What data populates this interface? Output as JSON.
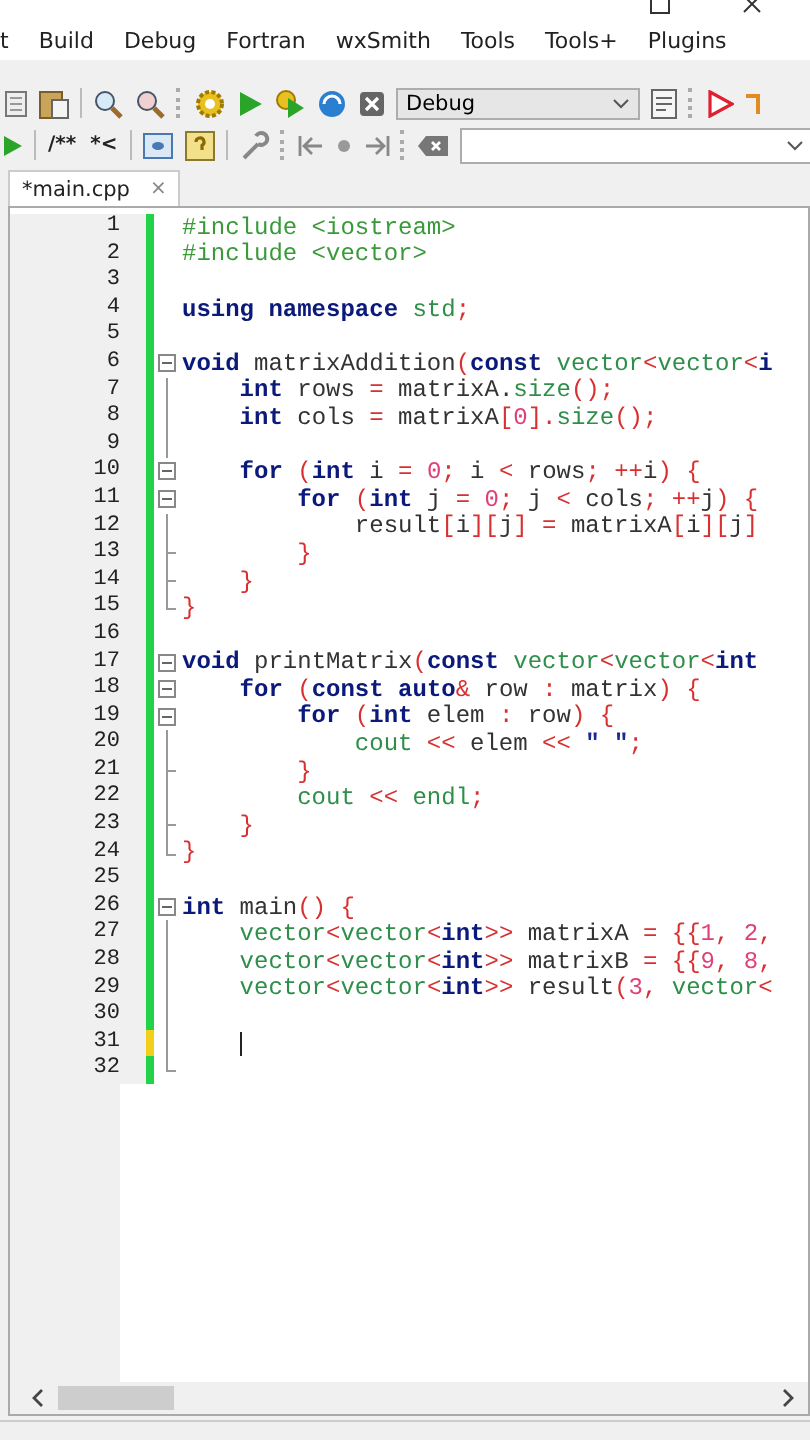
{
  "menu": [
    "t",
    "Build",
    "Debug",
    "Fortran",
    "wxSmith",
    "Tools",
    "Tools+",
    "Plugins"
  ],
  "toolbar": {
    "target": "Debug",
    "doc_buttons": [
      "/**",
      "*<"
    ]
  },
  "tabs": [
    {
      "label": "*main.cpp",
      "close": "×",
      "selected": true
    }
  ],
  "lines": [
    {
      "number": "1",
      "color": "#22d34a",
      "kind": "plain",
      "caret": false,
      "tokens": [
        {
          "t": "#include <iostream>",
          "kind": "pre"
        }
      ]
    },
    {
      "number": "2",
      "color": "#22d34a",
      "kind": "plain",
      "caret": false,
      "tokens": [
        {
          "t": "#include <vector>",
          "kind": "pre"
        }
      ]
    },
    {
      "number": "3",
      "color": "#22d34a",
      "kind": "plain",
      "caret": false
    },
    {
      "number": "4",
      "color": "#22d34a",
      "kind": "plain",
      "caret": false,
      "tokens": [
        {
          "t": "using namespace",
          "kind": "kw"
        },
        {
          "t": " std",
          "kind": "lib"
        },
        {
          "t": ";",
          "kind": "p"
        }
      ]
    },
    {
      "number": "5",
      "color": "#22d34a",
      "kind": "plain",
      "caret": false
    },
    {
      "number": "6",
      "color": "#22d34a",
      "kind": "start",
      "caret": false,
      "tokens": [
        {
          "t": "void",
          "kind": "kw"
        },
        {
          "t": " matrixAddition",
          "kind": "id"
        },
        {
          "t": "(",
          "kind": "p"
        },
        {
          "t": "const",
          "kind": "kw"
        },
        {
          "t": " vector",
          "kind": "lib"
        },
        {
          "t": "<",
          "kind": "p"
        },
        {
          "t": "vector",
          "kind": "lib"
        },
        {
          "t": "<",
          "kind": "p"
        },
        {
          "t": "i",
          "kind": "kw"
        }
      ]
    },
    {
      "number": "7",
      "color": "#22d34a",
      "kind": "inside",
      "caret": false,
      "tokens": [
        {
          "t": "    int",
          "kind": "kw"
        },
        {
          "t": " rows ",
          "kind": "id"
        },
        {
          "t": "=",
          "kind": "p"
        },
        {
          "t": " matrixA.",
          "kind": "id"
        },
        {
          "t": "size",
          "kind": "lib"
        },
        {
          "t": "();",
          "kind": "p"
        }
      ]
    },
    {
      "number": "8",
      "color": "#22d34a",
      "kind": "inside",
      "caret": false,
      "tokens": [
        {
          "t": "    int",
          "kind": "kw"
        },
        {
          "t": " cols ",
          "kind": "id"
        },
        {
          "t": "=",
          "kind": "p"
        },
        {
          "t": " matrixA",
          "kind": "id"
        },
        {
          "t": "[",
          "kind": "p"
        },
        {
          "t": "0",
          "kind": "num"
        },
        {
          "t": "].",
          "kind": "p"
        },
        {
          "t": "size",
          "kind": "lib"
        },
        {
          "t": "();",
          "kind": "p"
        }
      ]
    },
    {
      "number": "9",
      "color": "#22d34a",
      "kind": "inside",
      "caret": false
    },
    {
      "number": "10",
      "color": "#22d34a",
      "kind": "start",
      "caret": false,
      "tokens": [
        {
          "t": "    for",
          "kind": "kw"
        },
        {
          "t": " (",
          "kind": "p"
        },
        {
          "t": "int",
          "kind": "kw"
        },
        {
          "t": " i ",
          "kind": "id"
        },
        {
          "t": "=",
          "kind": "p"
        },
        {
          "t": " 0",
          "kind": "num"
        },
        {
          "t": ";",
          "kind": "p"
        },
        {
          "t": " i ",
          "kind": "id"
        },
        {
          "t": "<",
          "kind": "p"
        },
        {
          "t": " rows",
          "kind": "id"
        },
        {
          "t": ";",
          "kind": "p"
        },
        {
          "t": " ++",
          "kind": "p"
        },
        {
          "t": "i",
          "kind": "id"
        },
        {
          "t": ")",
          "kind": "p"
        },
        {
          "t": " {",
          "kind": "p"
        }
      ]
    },
    {
      "number": "11",
      "color": "#22d34a",
      "kind": "start",
      "caret": false,
      "tokens": [
        {
          "t": "        for",
          "kind": "kw"
        },
        {
          "t": " (",
          "kind": "p"
        },
        {
          "t": "int",
          "kind": "kw"
        },
        {
          "t": " j ",
          "kind": "id"
        },
        {
          "t": "=",
          "kind": "p"
        },
        {
          "t": " 0",
          "kind": "num"
        },
        {
          "t": ";",
          "kind": "p"
        },
        {
          "t": " j ",
          "kind": "id"
        },
        {
          "t": "<",
          "kind": "p"
        },
        {
          "t": " cols",
          "kind": "id"
        },
        {
          "t": ";",
          "kind": "p"
        },
        {
          "t": " ++",
          "kind": "p"
        },
        {
          "t": "j",
          "kind": "id"
        },
        {
          "t": ")",
          "kind": "p"
        },
        {
          "t": " {",
          "kind": "p"
        }
      ]
    },
    {
      "number": "12",
      "color": "#22d34a",
      "kind": "inside",
      "caret": false,
      "tokens": [
        {
          "t": "            result",
          "kind": "id"
        },
        {
          "t": "[",
          "kind": "p"
        },
        {
          "t": "i",
          "kind": "id"
        },
        {
          "t": "][",
          "kind": "p"
        },
        {
          "t": "j",
          "kind": "id"
        },
        {
          "t": "]",
          "kind": "p"
        },
        {
          "t": " =",
          "kind": "p"
        },
        {
          "t": " matrixA",
          "kind": "id"
        },
        {
          "t": "[",
          "kind": "p"
        },
        {
          "t": "i",
          "kind": "id"
        },
        {
          "t": "][",
          "kind": "p"
        },
        {
          "t": "j",
          "kind": "id"
        },
        {
          "t": "]",
          "kind": "p"
        }
      ]
    },
    {
      "number": "13",
      "color": "#22d34a",
      "kind": "branch",
      "caret": false,
      "tokens": [
        {
          "t": "        }",
          "kind": "p"
        }
      ]
    },
    {
      "number": "14",
      "color": "#22d34a",
      "kind": "branch",
      "caret": false,
      "tokens": [
        {
          "t": "    }",
          "kind": "p"
        }
      ]
    },
    {
      "number": "15",
      "color": "#22d34a",
      "kind": "end",
      "caret": false,
      "tokens": [
        {
          "t": "}",
          "kind": "p"
        }
      ]
    },
    {
      "number": "16",
      "color": "#22d34a",
      "kind": "plain",
      "caret": false
    },
    {
      "number": "17",
      "color": "#22d34a",
      "kind": "start",
      "caret": false,
      "tokens": [
        {
          "t": "void",
          "kind": "kw"
        },
        {
          "t": " printMatrix",
          "kind": "id"
        },
        {
          "t": "(",
          "kind": "p"
        },
        {
          "t": "const",
          "kind": "kw"
        },
        {
          "t": " vector",
          "kind": "lib"
        },
        {
          "t": "<",
          "kind": "p"
        },
        {
          "t": "vector",
          "kind": "lib"
        },
        {
          "t": "<",
          "kind": "p"
        },
        {
          "t": "int",
          "kind": "kw"
        }
      ]
    },
    {
      "number": "18",
      "color": "#22d34a",
      "kind": "start",
      "caret": false,
      "tokens": [
        {
          "t": "    for",
          "kind": "kw"
        },
        {
          "t": " (",
          "kind": "p"
        },
        {
          "t": "const auto",
          "kind": "kw"
        },
        {
          "t": "&",
          "kind": "p"
        },
        {
          "t": " row ",
          "kind": "id"
        },
        {
          "t": ":",
          "kind": "p"
        },
        {
          "t": " matrix",
          "kind": "id"
        },
        {
          "t": ")",
          "kind": "p"
        },
        {
          "t": " {",
          "kind": "p"
        }
      ]
    },
    {
      "number": "19",
      "color": "#22d34a",
      "kind": "start",
      "caret": false,
      "tokens": [
        {
          "t": "        for",
          "kind": "kw"
        },
        {
          "t": " (",
          "kind": "p"
        },
        {
          "t": "int",
          "kind": "kw"
        },
        {
          "t": " elem ",
          "kind": "id"
        },
        {
          "t": ":",
          "kind": "p"
        },
        {
          "t": " row",
          "kind": "id"
        },
        {
          "t": ")",
          "kind": "p"
        },
        {
          "t": " {",
          "kind": "p"
        }
      ]
    },
    {
      "number": "20",
      "color": "#22d34a",
      "kind": "inside",
      "caret": false,
      "tokens": [
        {
          "t": "            cout",
          "kind": "lib"
        },
        {
          "t": " <<",
          "kind": "p"
        },
        {
          "t": " elem ",
          "kind": "id"
        },
        {
          "t": "<<",
          "kind": "p"
        },
        {
          "t": " \" \"",
          "kind": "str"
        },
        {
          "t": ";",
          "kind": "p"
        }
      ]
    },
    {
      "number": "21",
      "color": "#22d34a",
      "kind": "branch",
      "caret": false,
      "tokens": [
        {
          "t": "        }",
          "kind": "p"
        }
      ]
    },
    {
      "number": "22",
      "color": "#22d34a",
      "kind": "inside",
      "caret": false,
      "tokens": [
        {
          "t": "        cout",
          "kind": "lib"
        },
        {
          "t": " <<",
          "kind": "p"
        },
        {
          "t": " endl",
          "kind": "lib"
        },
        {
          "t": ";",
          "kind": "p"
        }
      ]
    },
    {
      "number": "23",
      "color": "#22d34a",
      "kind": "branch",
      "caret": false,
      "tokens": [
        {
          "t": "    }",
          "kind": "p"
        }
      ]
    },
    {
      "number": "24",
      "color": "#22d34a",
      "kind": "end",
      "caret": false,
      "tokens": [
        {
          "t": "}",
          "kind": "p"
        }
      ]
    },
    {
      "number": "25",
      "color": "#22d34a",
      "kind": "plain",
      "caret": false
    },
    {
      "number": "26",
      "color": "#22d34a",
      "kind": "start",
      "caret": false,
      "tokens": [
        {
          "t": "int",
          "kind": "kw"
        },
        {
          "t": " main",
          "kind": "id"
        },
        {
          "t": "()",
          "kind": "p"
        },
        {
          "t": " {",
          "kind": "p"
        }
      ]
    },
    {
      "number": "27",
      "color": "#22d34a",
      "kind": "inside",
      "caret": false,
      "tokens": [
        {
          "t": "    vector",
          "kind": "lib"
        },
        {
          "t": "<",
          "kind": "p"
        },
        {
          "t": "vector",
          "kind": "lib"
        },
        {
          "t": "<",
          "kind": "p"
        },
        {
          "t": "int",
          "kind": "kw"
        },
        {
          "t": ">>",
          "kind": "p"
        },
        {
          "t": " matrixA ",
          "kind": "id"
        },
        {
          "t": "=",
          "kind": "p"
        },
        {
          "t": " {{",
          "kind": "p"
        },
        {
          "t": "1",
          "kind": "num"
        },
        {
          "t": ",",
          "kind": "p"
        },
        {
          "t": " 2",
          "kind": "num"
        },
        {
          "t": ",",
          "kind": "p"
        }
      ]
    },
    {
      "number": "28",
      "color": "#22d34a",
      "kind": "inside",
      "caret": false,
      "tokens": [
        {
          "t": "    vector",
          "kind": "lib"
        },
        {
          "t": "<",
          "kind": "p"
        },
        {
          "t": "vector",
          "kind": "lib"
        },
        {
          "t": "<",
          "kind": "p"
        },
        {
          "t": "int",
          "kind": "kw"
        },
        {
          "t": ">>",
          "kind": "p"
        },
        {
          "t": " matrixB ",
          "kind": "id"
        },
        {
          "t": "=",
          "kind": "p"
        },
        {
          "t": " {{",
          "kind": "p"
        },
        {
          "t": "9",
          "kind": "num"
        },
        {
          "t": ",",
          "kind": "p"
        },
        {
          "t": " 8",
          "kind": "num"
        },
        {
          "t": ",",
          "kind": "p"
        }
      ]
    },
    {
      "number": "29",
      "color": "#22d34a",
      "kind": "inside",
      "caret": false,
      "tokens": [
        {
          "t": "    vector",
          "kind": "lib"
        },
        {
          "t": "<",
          "kind": "p"
        },
        {
          "t": "vector",
          "kind": "lib"
        },
        {
          "t": "<",
          "kind": "p"
        },
        {
          "t": "int",
          "kind": "kw"
        },
        {
          "t": ">>",
          "kind": "p"
        },
        {
          "t": " result",
          "kind": "id"
        },
        {
          "t": "(",
          "kind": "p"
        },
        {
          "t": "3",
          "kind": "num"
        },
        {
          "t": ",",
          "kind": "p"
        },
        {
          "t": " vector",
          "kind": "lib"
        },
        {
          "t": "<",
          "kind": "p"
        }
      ]
    },
    {
      "number": "30",
      "color": "#22d34a",
      "kind": "inside",
      "caret": false
    },
    {
      "number": "31",
      "color": "#f2cf1a",
      "kind": "inside",
      "caret": true
    },
    {
      "number": "32",
      "color": "#22d34a",
      "kind": "end",
      "caret": false
    }
  ]
}
